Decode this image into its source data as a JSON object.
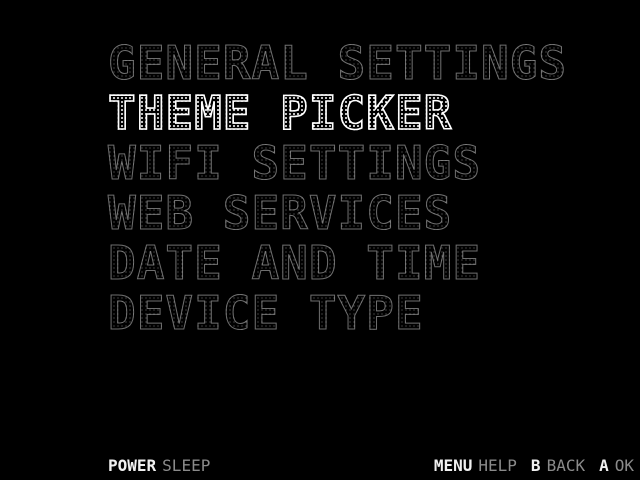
{
  "menu": {
    "items": [
      {
        "label": "GENERAL SETTINGS",
        "selected": false
      },
      {
        "label": "THEME PICKER",
        "selected": true
      },
      {
        "label": "WIFI SETTINGS",
        "selected": false
      },
      {
        "label": "WEB SERVICES",
        "selected": false
      },
      {
        "label": "DATE AND TIME",
        "selected": false
      },
      {
        "label": "DEVICE TYPE",
        "selected": false
      }
    ]
  },
  "footer": {
    "power_button": "POWER",
    "power_action": "SLEEP",
    "menu_button": "MENU",
    "menu_action": "HELP",
    "b_button": "B",
    "b_action": "BACK",
    "a_button": "A",
    "a_action": "OK"
  },
  "colors": {
    "background": "#000000",
    "text_selected": "#ffffff",
    "text_normal": "#bfbfbf",
    "hint_action": "#8a8a8a"
  }
}
